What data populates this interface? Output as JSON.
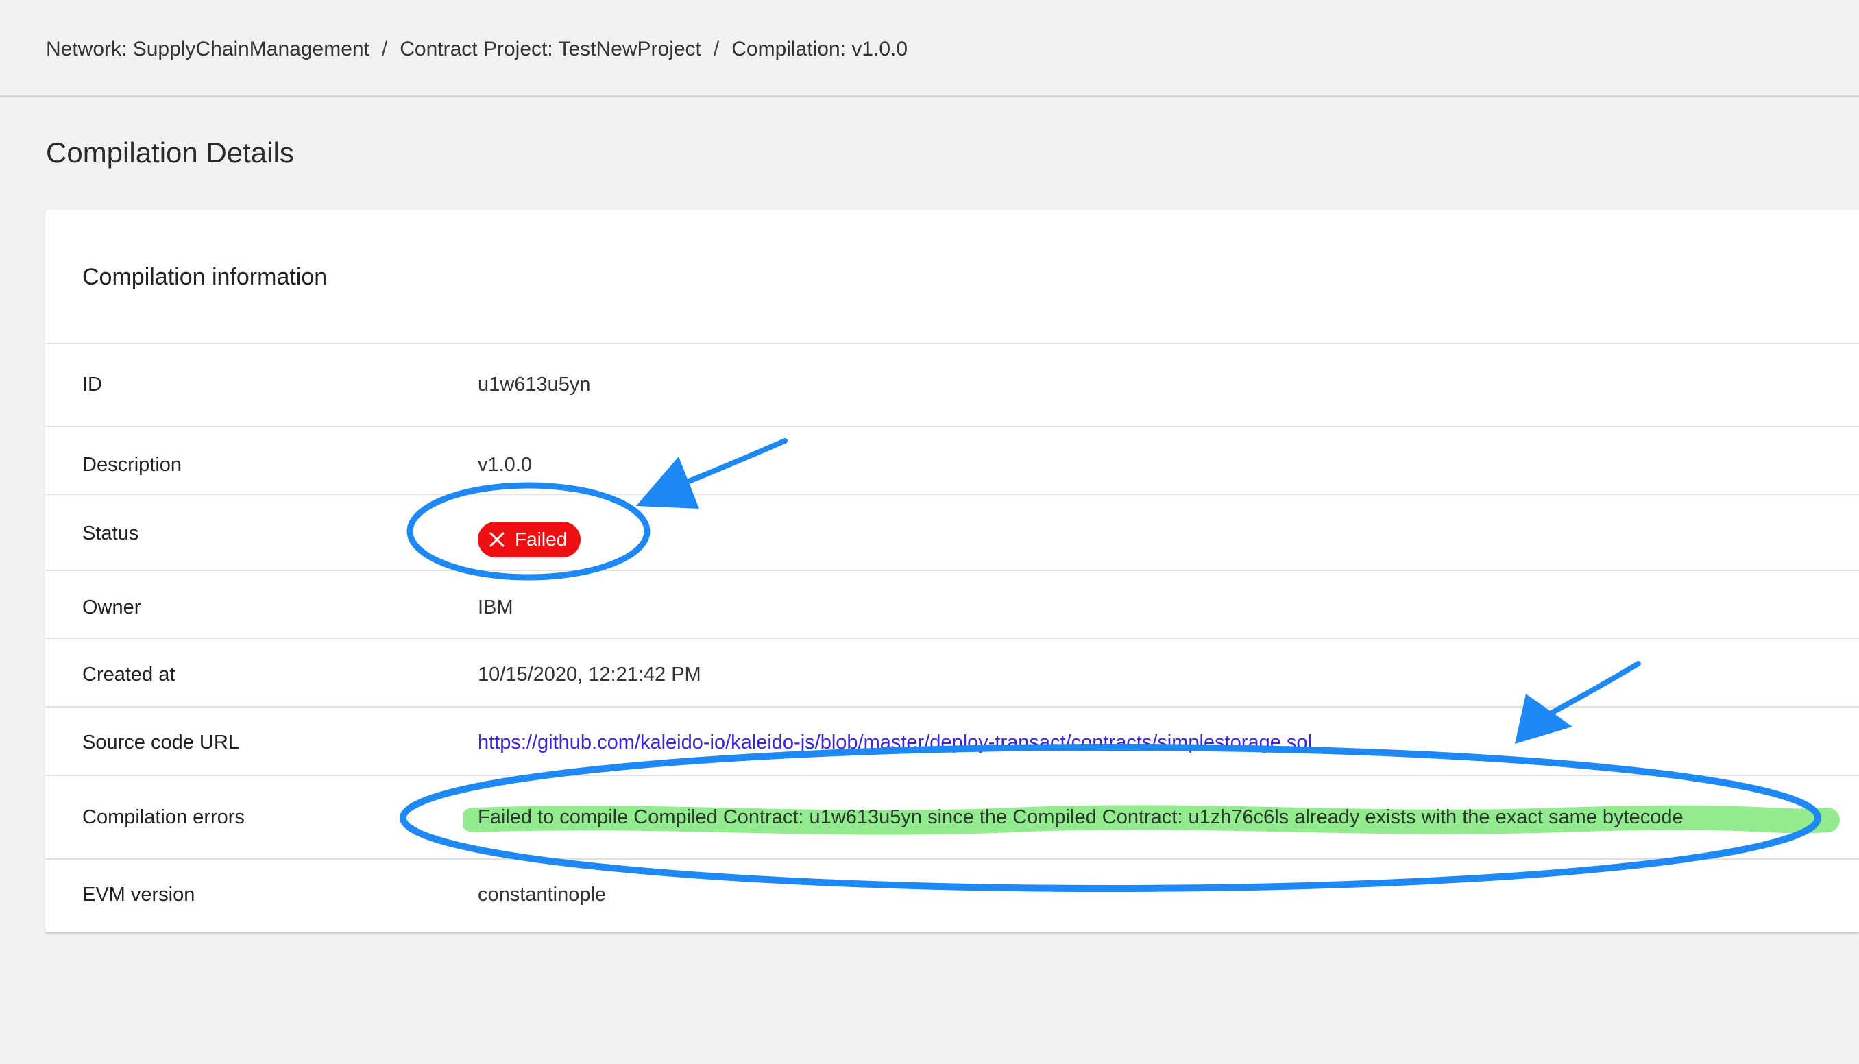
{
  "breadcrumb": {
    "network": "Network: SupplyChainManagement",
    "project": "Contract Project: TestNewProject",
    "current": "Compilation: v1.0.0",
    "separator": "/"
  },
  "page": {
    "title": "Compilation Details"
  },
  "card": {
    "title": "Compilation information",
    "rows": {
      "id": {
        "label": "ID",
        "value": "u1w613u5yn"
      },
      "description": {
        "label": "Description",
        "value": "v1.0.0"
      },
      "status": {
        "label": "Status",
        "value": "Failed",
        "icon": "close-icon",
        "color": "#ee1111"
      },
      "owner": {
        "label": "Owner",
        "value": "IBM"
      },
      "created": {
        "label": "Created at",
        "value": "10/15/2020, 12:21:42 PM"
      },
      "source": {
        "label": "Source code URL",
        "value": "https://github.com/kaleido-io/kaleido-js/blob/master/deploy-transact/contracts/simplestorage.sol"
      },
      "errors": {
        "label": "Compilation errors",
        "value": "Failed to compile Compiled Contract: u1w613u5yn since the Compiled Contract: u1zh76c6ls already exists with the exact same bytecode"
      },
      "evm": {
        "label": "EVM version",
        "value": "constantinople"
      }
    }
  },
  "annotations": {
    "circle_color": "#1e88f5",
    "arrow_color": "#1e88f5",
    "highlight_color": "#7fe87a"
  }
}
